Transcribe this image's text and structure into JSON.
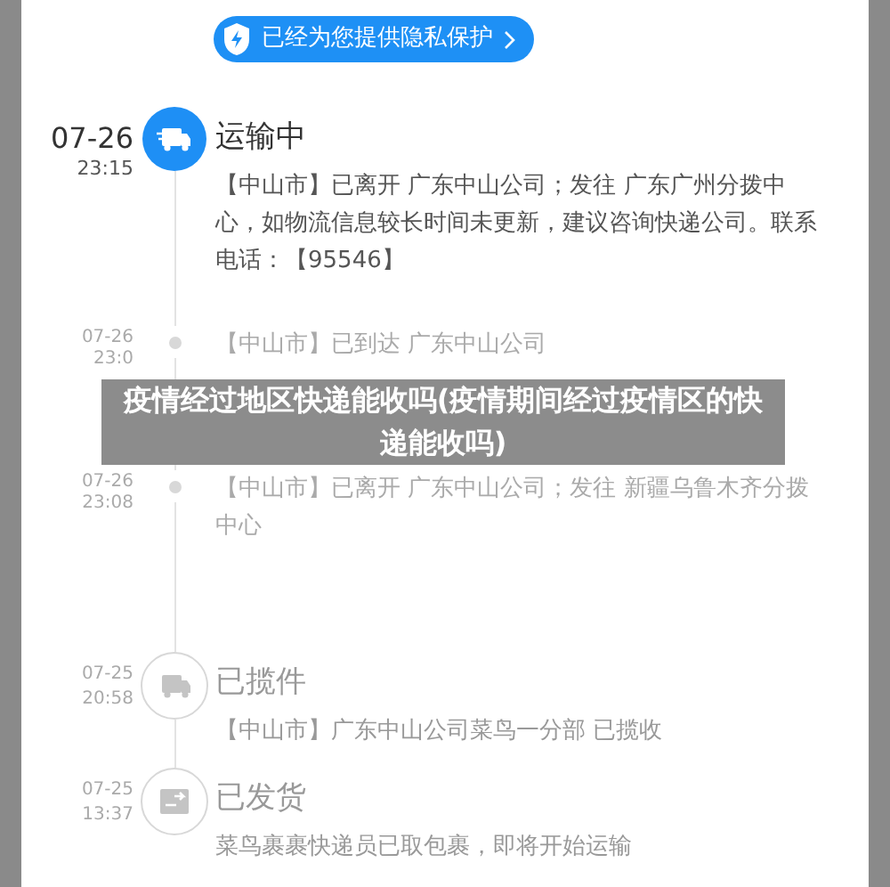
{
  "privacy_button": {
    "label": "已经为您提供隐私保护"
  },
  "events": [
    {
      "kind": "transit",
      "active": true,
      "date": "07-26",
      "time": "23:15",
      "title": "运输中",
      "description": "【中山市】已离开 广东中山公司；发往 广东广州分拨中心，如物流信息较长时间未更新，建议咨询快递公司。联系电话：【95546】"
    },
    {
      "kind": "minor",
      "date": "07-26",
      "time": "23:0",
      "description": "【中山市】已到达 广东中山公司"
    },
    {
      "kind": "minor",
      "date": "07-26",
      "time": "23:08",
      "description": "【中山市】已离开 广东中山公司；发往 新疆乌鲁木齐分拨中心"
    },
    {
      "kind": "collected",
      "active": false,
      "date": "07-25",
      "time": "20:58",
      "title": "已揽件",
      "description": "【中山市】广东中山公司菜鸟一分部 已揽收"
    },
    {
      "kind": "shipped",
      "active": false,
      "date": "07-25",
      "time": "13:37",
      "title": "已发货",
      "description": "菜鸟裹裹快递员已取包裹，即将开始运输"
    }
  ],
  "banner": {
    "text": "疫情经过地区快递能收吗(疫情期间经过疫情区的快递能收吗)"
  }
}
